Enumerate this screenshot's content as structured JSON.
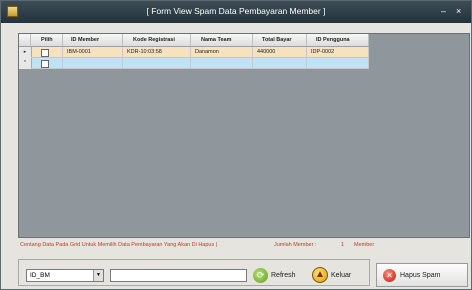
{
  "window": {
    "title": "[ Form View Spam Data Pembayaran Member ]",
    "minimize": "–",
    "close": "×"
  },
  "grid": {
    "columns": [
      "Pilih",
      "ID Member",
      "Kode Registrasi",
      "Nama Team",
      "Total Bayar",
      "ID Pengguna"
    ],
    "rows": [
      {
        "indicator": "▸",
        "checked": false,
        "cells": [
          "IBM-0001",
          "KDR-10:03:58",
          "Danamon",
          "440000",
          "IDP-0002"
        ]
      },
      {
        "indicator": "*",
        "checked": false,
        "cells": [
          "",
          "",
          "",
          "",
          ""
        ]
      }
    ]
  },
  "status": {
    "hint": "Centang Data Pada Grid Untuk Memilih Data Pembayaran Yang Akan Di Hapus |",
    "member_label": "Jumlah Member :",
    "member_count": "1",
    "member_unit": "Member"
  },
  "filter": {
    "field_value": "ID_BM",
    "search_value": ""
  },
  "buttons": {
    "refresh": "Refresh",
    "keluar": "Keluar",
    "hapus": "Hapus Spam"
  },
  "colors": {
    "titlebar": "#2c3b43",
    "grid_background": "#8f979d",
    "selected_row": "#f7e2c0",
    "new_row": "#bfe3f5",
    "hint_text": "#c0392b"
  }
}
